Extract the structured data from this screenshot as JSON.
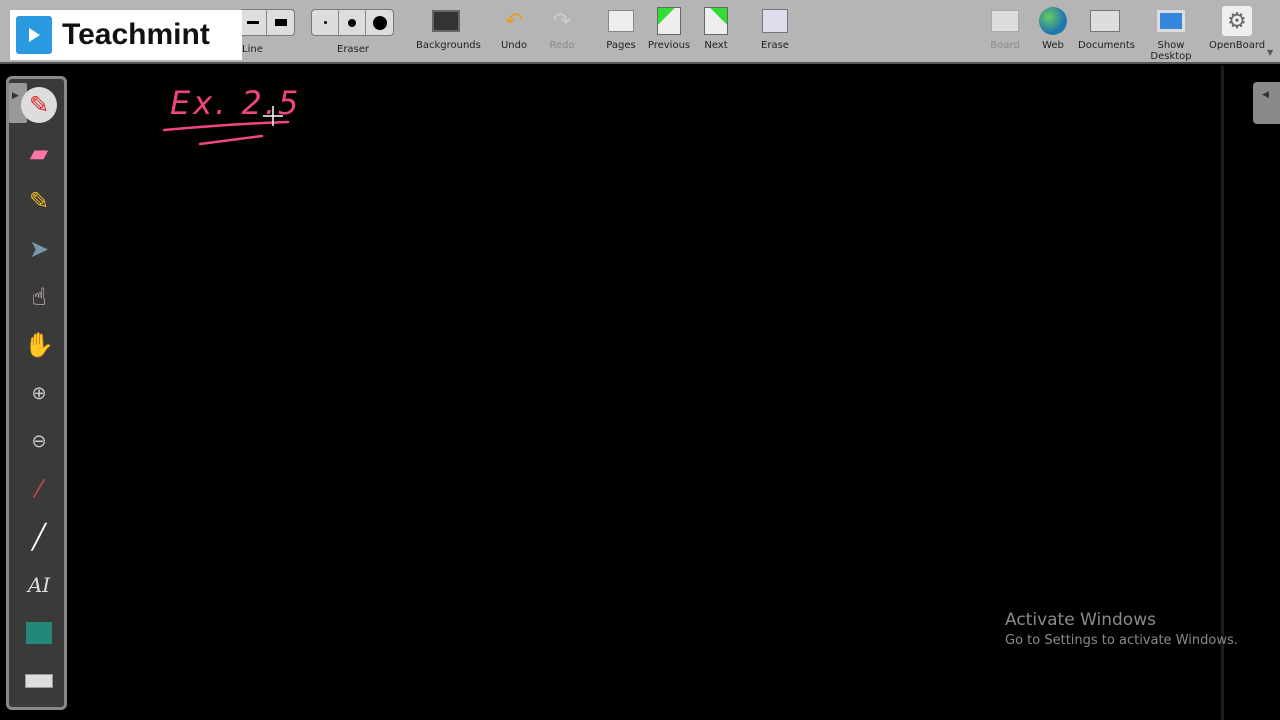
{
  "logo": {
    "text": "Teachmint"
  },
  "toolbar": {
    "line_label": "Line",
    "eraser_label": "Eraser",
    "backgrounds": "Backgrounds",
    "undo": "Undo",
    "redo": "Redo",
    "pages": "Pages",
    "previous": "Previous",
    "next": "Next",
    "erase": "Erase",
    "board": "Board",
    "web": "Web",
    "documents": "Documents",
    "show_desktop": "Show Desktop",
    "openboard": "OpenBoard"
  },
  "board": {
    "handwriting": "Ex. 2.5",
    "ink_color": "#f0457f"
  },
  "watermark": {
    "title": "Activate Windows",
    "subtitle": "Go to Settings to activate Windows."
  },
  "palette": {
    "tools": [
      "pen-icon",
      "eraser-icon",
      "highlighter-icon",
      "pointer-icon",
      "laser-pointer-icon",
      "hand-icon",
      "zoom-in-icon",
      "zoom-out-icon",
      "capture-icon",
      "line-icon",
      "text-icon",
      "screen-icon",
      "keyboard-icon"
    ]
  }
}
